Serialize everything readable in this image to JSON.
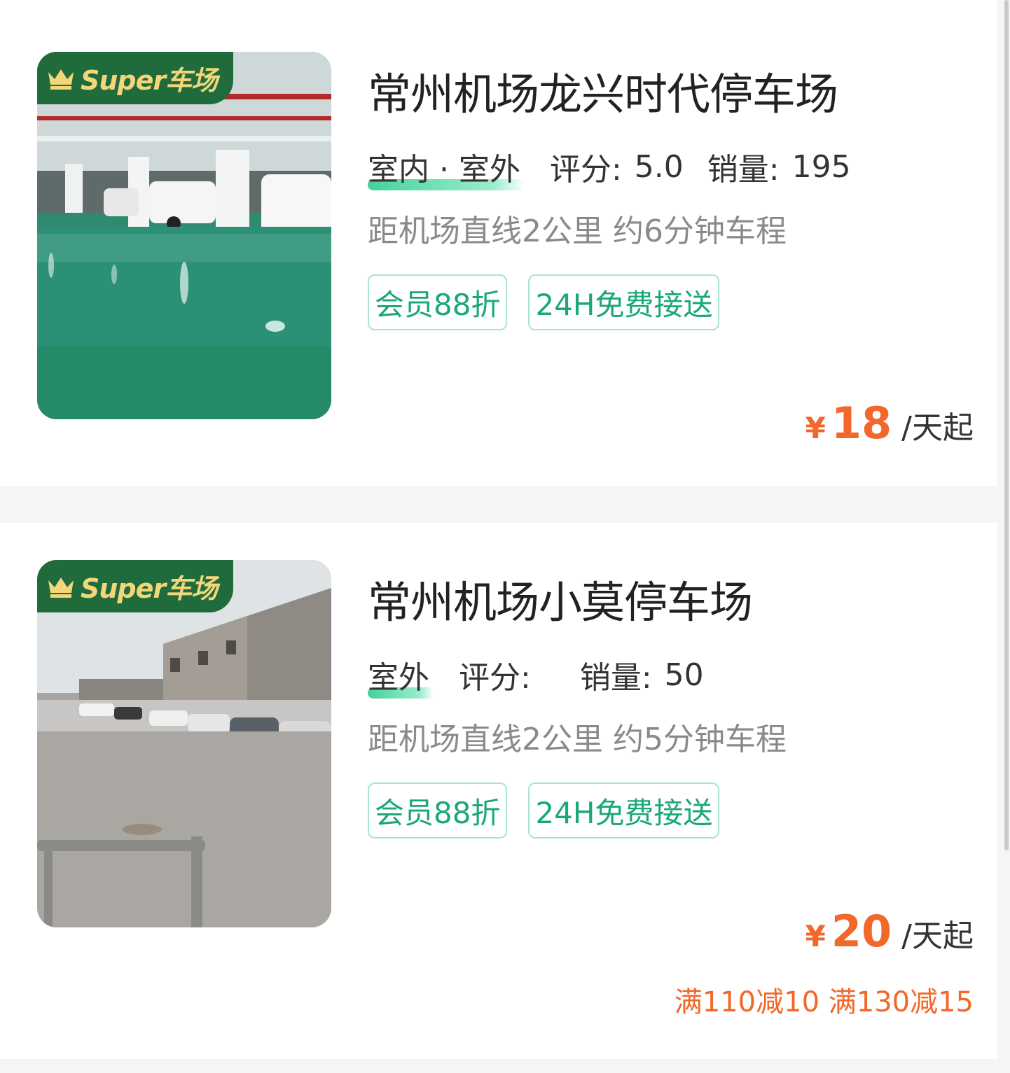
{
  "theme": {
    "accent_green": "#1aa779",
    "price_orange": "#f2672a",
    "badge_green": "#1f6b3c",
    "badge_gold": "#f3d67a"
  },
  "lots": [
    {
      "badge": "Super车场",
      "badge_icon": "crown-icon",
      "name": "常州机场龙兴时代停车场",
      "type": "室内 · 室外",
      "rating_label": "评分:",
      "rating": "5.0",
      "sales_label": "销量:",
      "sales": "195",
      "distance": "距机场直线2公里 约6分钟车程",
      "tags": [
        "会员88折",
        "24H免费接送"
      ],
      "currency": "¥",
      "price": "18",
      "price_unit": "/天起",
      "promo": ""
    },
    {
      "badge": "Super车场",
      "badge_icon": "crown-icon",
      "name": "常州机场小莫停车场",
      "type": "室外",
      "rating_label": "评分:",
      "rating": "",
      "sales_label": "销量:",
      "sales": "50",
      "distance": "距机场直线2公里 约5分钟车程",
      "tags": [
        "会员88折",
        "24H免费接送"
      ],
      "currency": "¥",
      "price": "20",
      "price_unit": "/天起",
      "promo": "满110减10 满130减15"
    }
  ]
}
